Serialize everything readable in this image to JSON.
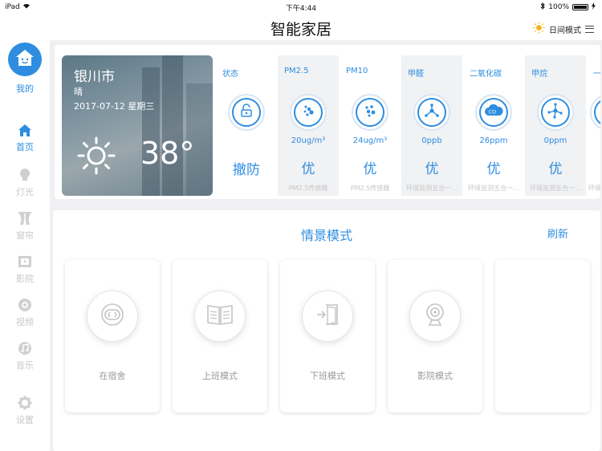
{
  "statusbar": {
    "device": "iPad",
    "time": "下午4:44",
    "battery": "100%"
  },
  "header": {
    "title": "智能家居",
    "mode_label": "日间模式"
  },
  "sidebar": {
    "profile_label": "我的",
    "items": [
      {
        "label": "首页",
        "icon": "home-icon",
        "active": true
      },
      {
        "label": "灯光",
        "icon": "bulb-icon",
        "active": false
      },
      {
        "label": "窗帘",
        "icon": "curtain-icon",
        "active": false
      },
      {
        "label": "影院",
        "icon": "film-icon",
        "active": false
      },
      {
        "label": "视频",
        "icon": "camera-icon",
        "active": false
      },
      {
        "label": "音乐",
        "icon": "music-icon",
        "active": false
      },
      {
        "label": "设置",
        "icon": "gear-icon",
        "active": false
      }
    ]
  },
  "weather": {
    "city": "银川市",
    "condition": "晴",
    "date": "2017-07-12  星期三",
    "temperature": "38°"
  },
  "sensors": [
    {
      "title": "状态",
      "value": "",
      "grade": "撤防",
      "source": "",
      "icon": "lock-icon"
    },
    {
      "title": "PM2.5",
      "value": "20ug/m³",
      "grade": "优",
      "source": "PM2.5传感器",
      "icon": "dots-icon"
    },
    {
      "title": "PM10",
      "value": "24ug/m³",
      "grade": "优",
      "source": "PM2.5传感器",
      "icon": "dots-icon"
    },
    {
      "title": "甲醛",
      "value": "0ppb",
      "grade": "优",
      "source": "环境监测五合一...",
      "icon": "molecule-icon"
    },
    {
      "title": "二氧化碳",
      "value": "26ppm",
      "grade": "优",
      "source": "环境监测五合一...",
      "icon": "co2-cloud-icon"
    },
    {
      "title": "甲烷",
      "value": "0ppm",
      "grade": "优",
      "source": "环境监测五合一...",
      "icon": "molecule-icon"
    },
    {
      "title": "一氧",
      "value": "",
      "grade": "",
      "source": "环境",
      "icon": "partial-icon"
    }
  ],
  "scenes": {
    "title": "情景模式",
    "refresh_label": "刷新",
    "items": [
      {
        "label": "在宿舍",
        "icon": "socket-icon"
      },
      {
        "label": "上班模式",
        "icon": "book-icon"
      },
      {
        "label": "下班模式",
        "icon": "exit-door-icon"
      },
      {
        "label": "影院模式",
        "icon": "webcam-icon"
      },
      {
        "label": "",
        "icon": ""
      }
    ]
  },
  "colors": {
    "accent": "#2e8de0",
    "inactive": "#c8c8c8",
    "background": "#f0f0f2"
  }
}
